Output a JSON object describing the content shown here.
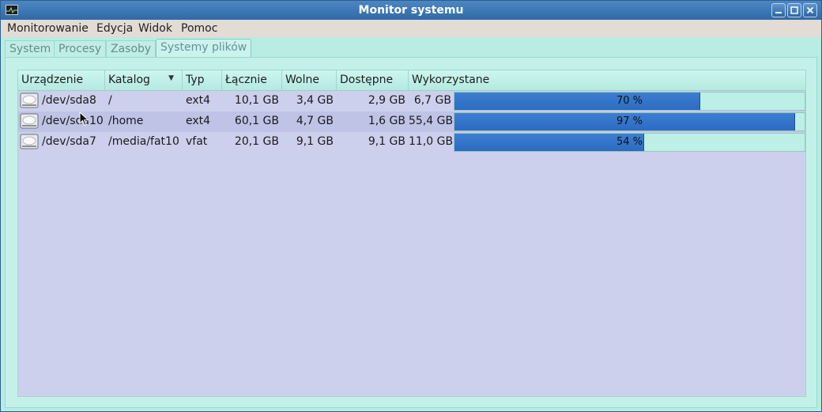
{
  "window": {
    "title": "Monitor systemu"
  },
  "menu": [
    "Monitorowanie",
    "Edycja",
    "Widok",
    "Pomoc"
  ],
  "tabs": [
    {
      "label": "System",
      "active": false
    },
    {
      "label": "Procesy",
      "active": false
    },
    {
      "label": "Zasoby",
      "active": false
    },
    {
      "label": "Systemy plików",
      "active": true
    }
  ],
  "columns": {
    "device": "Urządzenie",
    "directory": "Katalog",
    "type": "Typ",
    "total": "Łącznie",
    "free": "Wolne",
    "available": "Dostępne",
    "used": "Wykorzystane"
  },
  "filesystems": [
    {
      "device": "/dev/sda8",
      "directory": "/",
      "type": "ext4",
      "total": "10,1 GB",
      "free": "3,4 GB",
      "available": "2,9 GB",
      "used": "6,7 GB",
      "percent": 70,
      "percent_label": "70 %"
    },
    {
      "device": "/dev/sda10",
      "directory": "/home",
      "type": "ext4",
      "total": "60,1 GB",
      "free": "4,7 GB",
      "available": "1,6 GB",
      "used": "55,4 GB",
      "percent": 97,
      "percent_label": "97 %"
    },
    {
      "device": "/dev/sda7",
      "directory": "/media/fat10",
      "type": "vfat",
      "total": "20,1 GB",
      "free": "9,1 GB",
      "available": "9,1 GB",
      "used": "11,0 GB",
      "percent": 54,
      "percent_label": "54 %"
    }
  ],
  "colors": {
    "titlebar": "#3a75b4",
    "bar_fill": "#3577c9",
    "list_bg": "#cdd0ec"
  },
  "icons": {
    "app": "system-monitor-icon",
    "row": "hard-disk-icon",
    "minimize": "minimize-icon",
    "maximize": "maximize-icon",
    "close": "close-icon",
    "sort": "sort-descending-icon"
  }
}
